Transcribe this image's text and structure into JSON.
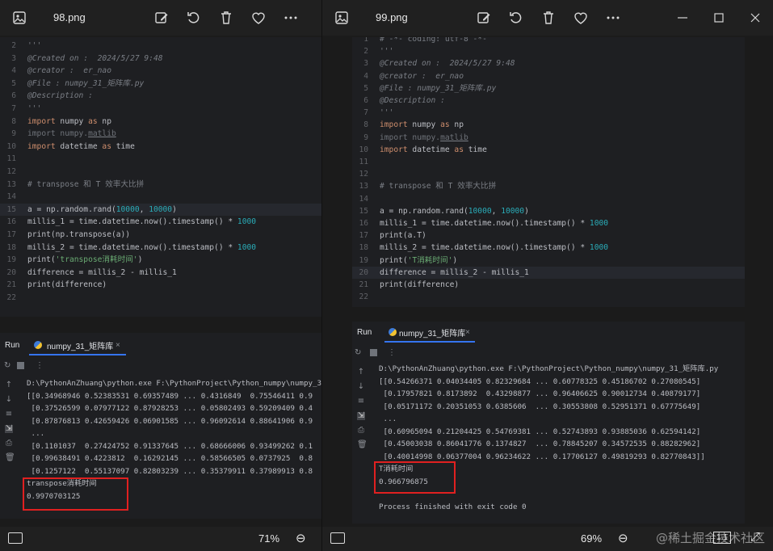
{
  "left": {
    "title": "98.png",
    "code": [
      {
        "n": "2",
        "t": "'''",
        "c": "cm"
      },
      {
        "n": "3",
        "t": "@Created on :  2024/5/27 9:48",
        "c": "cm"
      },
      {
        "n": "4",
        "t": "@creator :  er_nao",
        "c": "cm"
      },
      {
        "n": "5",
        "t": "@File : numpy_31_矩阵库.py",
        "c": "cm"
      },
      {
        "n": "6",
        "t": "@Description :",
        "c": "cm"
      },
      {
        "n": "7",
        "t": "'''",
        "c": "cm"
      },
      {
        "n": "8",
        "t": "import numpy as np",
        "c": "imp1"
      },
      {
        "n": "9",
        "t": "import numpy.matlib",
        "c": "imp2"
      },
      {
        "n": "10",
        "t": "import datetime as time",
        "c": "imp3"
      },
      {
        "n": "11",
        "t": "",
        "c": ""
      },
      {
        "n": "12",
        "t": "",
        "c": ""
      },
      {
        "n": "13",
        "t": "# transpose 和 T 效率大比拼",
        "c": "cm2"
      },
      {
        "n": "14",
        "t": "",
        "c": ""
      },
      {
        "n": "15",
        "t": "a = np.random.rand(10000, 10000)",
        "c": "rand"
      },
      {
        "n": "16",
        "t": "millis_1 = time.datetime.now().timestamp() * 1000",
        "c": "ts"
      },
      {
        "n": "17",
        "t": "print(np.transpose(a))",
        "c": "fn"
      },
      {
        "n": "18",
        "t": "millis_2 = time.datetime.now().timestamp() * 1000",
        "c": "ts"
      },
      {
        "n": "19",
        "t": "print('transpose消耗时间')",
        "c": "pstr"
      },
      {
        "n": "20",
        "t": "difference = millis_2 - millis_1",
        "c": "fn"
      },
      {
        "n": "21",
        "t": "print(difference)",
        "c": "fn"
      },
      {
        "n": "22",
        "t": "",
        "c": ""
      }
    ],
    "run_label": "Run",
    "run_tab": "numpy_31_矩阵库",
    "output": [
      "D:\\PythonAnZhuang\\python.exe F:\\PythonProject\\Python_numpy\\numpy_31_矩",
      "[[0.34968946 0.52383531 0.69357489 ... 0.4316849  0.75546411 0.9",
      " [0.37526599 0.07977122 0.87928253 ... 0.05802493 0.59209409 0.4",
      " [0.87876813 0.42659426 0.06901585 ... 0.96092614 0.88641906 0.9",
      " ...",
      " [0.1101037  0.27424752 0.91337645 ... 0.68666006 0.93499262 0.1",
      " [0.99638491 0.4223812  0.16292145 ... 0.58566505 0.0737925  0.8",
      " [0.1257122  0.55137097 0.82803239 ... 0.35379911 0.37989913 0.8",
      "transpose消耗时间",
      "0.9970703125"
    ],
    "zoom": "71%"
  },
  "right": {
    "title": "99.png",
    "code": [
      {
        "n": "1",
        "t": "# -*- coding: utf-8 -*-",
        "c": "cm2"
      },
      {
        "n": "2",
        "t": "'''",
        "c": "cm"
      },
      {
        "n": "3",
        "t": "@Created on :  2024/5/27 9:48",
        "c": "cm"
      },
      {
        "n": "4",
        "t": "@creator :  er_nao",
        "c": "cm"
      },
      {
        "n": "5",
        "t": "@File : numpy_31_矩阵库.py",
        "c": "cm"
      },
      {
        "n": "6",
        "t": "@Description :",
        "c": "cm"
      },
      {
        "n": "7",
        "t": "'''",
        "c": "cm"
      },
      {
        "n": "8",
        "t": "import numpy as np",
        "c": "imp1"
      },
      {
        "n": "9",
        "t": "import numpy.matlib",
        "c": "imp2"
      },
      {
        "n": "10",
        "t": "import datetime as time",
        "c": "imp3"
      },
      {
        "n": "11",
        "t": "",
        "c": ""
      },
      {
        "n": "12",
        "t": "",
        "c": ""
      },
      {
        "n": "13",
        "t": "# transpose 和 T 效率大比拼",
        "c": "cm2"
      },
      {
        "n": "14",
        "t": "",
        "c": ""
      },
      {
        "n": "15",
        "t": "a = np.random.rand(10000, 10000)",
        "c": "rand"
      },
      {
        "n": "16",
        "t": "millis_1 = time.datetime.now().timestamp() * 1000",
        "c": "ts"
      },
      {
        "n": "17",
        "t": "print(a.T)",
        "c": "fn"
      },
      {
        "n": "18",
        "t": "millis_2 = time.datetime.now().timestamp() * 1000",
        "c": "ts"
      },
      {
        "n": "19",
        "t": "print('T消耗时间')",
        "c": "pstr"
      },
      {
        "n": "20",
        "t": "difference = millis_2 - millis_1",
        "c": "fn"
      },
      {
        "n": "21",
        "t": "print(difference)",
        "c": "fn"
      },
      {
        "n": "22",
        "t": "",
        "c": ""
      }
    ],
    "run_label": "Run",
    "run_tab": "numpy_31_矩阵库",
    "output": [
      "D:\\PythonAnZhuang\\python.exe F:\\PythonProject\\Python_numpy\\numpy_31_矩阵库.py",
      "[[0.54266371 0.04034405 0.82329684 ... 0.60778325 0.45186702 0.27080545]",
      " [0.17957821 0.8173892  0.43298877 ... 0.96406625 0.90012734 0.40879177]",
      " [0.05171172 0.20351053 0.6385606  ... 0.30553808 0.52951371 0.67775649]",
      " ...",
      " [0.60965094 0.21204425 0.54769381 ... 0.52743893 0.93885036 0.62594142]",
      " [0.45003038 0.86041776 0.1374827  ... 0.78845207 0.34572535 0.88282962]",
      " [0.40014998 0.06377004 0.96234622 ... 0.17706127 0.49819293 0.82770843]]",
      "T消耗时间",
      "0.966796875",
      "",
      "Process finished with exit code 0"
    ],
    "zoom": "69%",
    "fit_label": "1:1",
    "watermark": "@稀土掘金技术社区"
  }
}
